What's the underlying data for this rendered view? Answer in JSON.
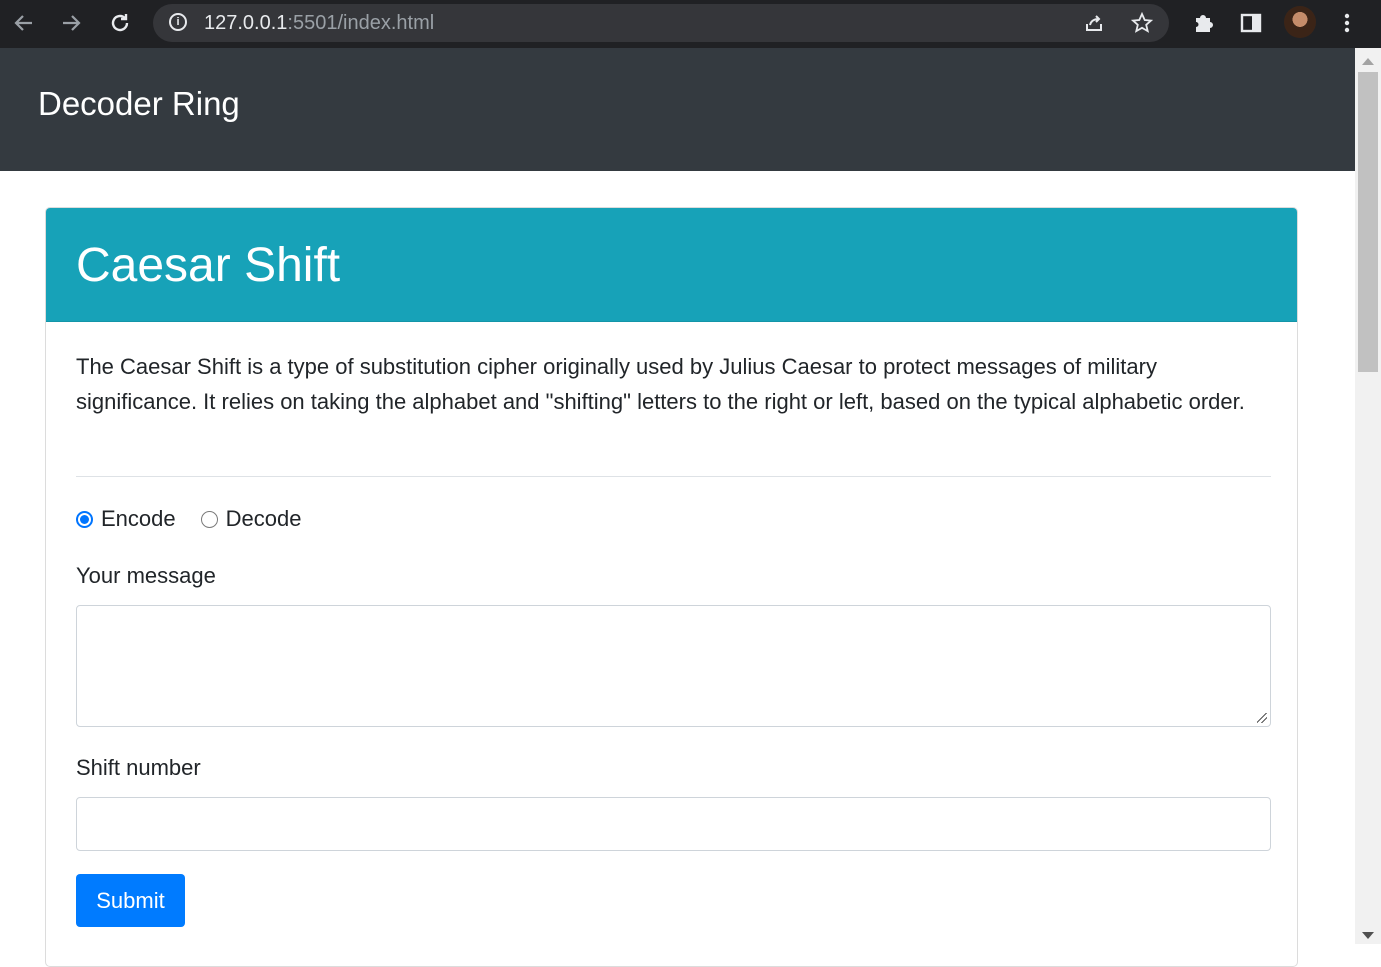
{
  "browser": {
    "url_host": "127.0.0.1",
    "url_rest": ":5501/index.html"
  },
  "navbar": {
    "brand": "Decoder Ring"
  },
  "card": {
    "title": "Caesar Shift",
    "description": "The Caesar Shift is a type of substitution cipher originally used by Julius Caesar to protect messages of military significance. It relies on taking the alphabet and \"shifting\" letters to the right or left, based on the typical alphabetic order.",
    "mode_options": [
      {
        "label": "Encode",
        "checked": true
      },
      {
        "label": "Decode",
        "checked": false
      }
    ],
    "message_label": "Your message",
    "message_value": "",
    "shift_label": "Shift number",
    "shift_value": "",
    "submit_label": "Submit"
  }
}
